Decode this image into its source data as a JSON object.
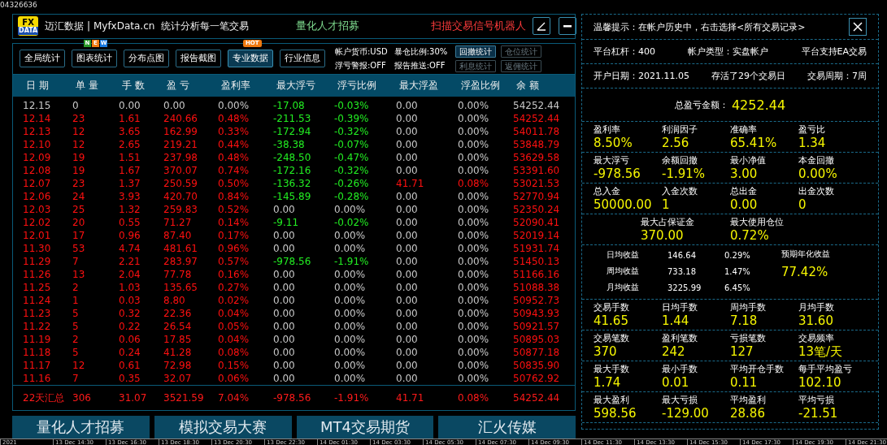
{
  "corner_id": "04326636",
  "header": {
    "logo_top": "FX",
    "logo_bottom": "DATA",
    "site": "迈汇数据 | MyfxData.cn",
    "slogan": "统计分析每一笔交易",
    "recruit": "量化人才招募",
    "robot": "扫描交易信号机器人"
  },
  "tabs": [
    {
      "label": "全局统计",
      "selected": false
    },
    {
      "label": "图表统计",
      "selected": false,
      "badge": {
        "kind": "letters",
        "letters": [
          "N",
          "E",
          "W"
        ]
      }
    },
    {
      "label": "分布点图",
      "selected": false
    },
    {
      "label": "报告截图",
      "selected": false
    },
    {
      "label": "专业数据",
      "selected": true,
      "badge": {
        "kind": "tag",
        "text": "HOT"
      }
    },
    {
      "label": "行业信息",
      "selected": false
    }
  ],
  "account_info": [
    "帐户货币:USD",
    "暴仓比例:30%",
    "浮亏警报:OFF",
    "报告推送:OFF"
  ],
  "side_buttons": [
    {
      "label": "回撤统计",
      "disabled": false
    },
    {
      "label": "仓位统计",
      "disabled": true
    },
    {
      "label": "利息统计",
      "disabled": true
    },
    {
      "label": "返佣统计",
      "disabled": true
    }
  ],
  "table": {
    "columns": [
      "日 期",
      "单 量",
      "手 数",
      "盈 亏",
      "盈利率",
      "最大浮亏",
      "浮亏比例",
      "最大浮盈",
      "浮盈比例",
      "余 额"
    ],
    "rows": [
      {
        "kind": "flat",
        "float_loss": true,
        "float_profit": false,
        "cells": [
          "12.15",
          "0",
          "0.00",
          "0.00",
          "0.00%",
          "-17.08",
          "-0.03%",
          "0.00",
          "0.00%",
          "54252.44"
        ]
      },
      {
        "kind": "gain",
        "float_loss": true,
        "float_profit": false,
        "cells": [
          "12.14",
          "23",
          "1.61",
          "240.66",
          "0.48%",
          "-211.53",
          "-0.39%",
          "0.00",
          "0.00%",
          "54252.44"
        ]
      },
      {
        "kind": "gain",
        "float_loss": true,
        "float_profit": false,
        "cells": [
          "12.13",
          "12",
          "3.65",
          "162.99",
          "0.33%",
          "-172.94",
          "-0.32%",
          "0.00",
          "0.00%",
          "54011.78"
        ]
      },
      {
        "kind": "gain",
        "float_loss": true,
        "float_profit": false,
        "cells": [
          "12.10",
          "12",
          "2.65",
          "219.21",
          "0.44%",
          "-38.38",
          "-0.07%",
          "0.00",
          "0.00%",
          "53848.79"
        ]
      },
      {
        "kind": "gain",
        "float_loss": true,
        "float_profit": false,
        "cells": [
          "12.09",
          "19",
          "1.51",
          "237.98",
          "0.48%",
          "-248.50",
          "-0.47%",
          "0.00",
          "0.00%",
          "53629.58"
        ]
      },
      {
        "kind": "gain",
        "float_loss": true,
        "float_profit": false,
        "cells": [
          "12.08",
          "19",
          "1.67",
          "370.07",
          "0.74%",
          "-172.16",
          "-0.32%",
          "0.00",
          "0.00%",
          "53391.60"
        ]
      },
      {
        "kind": "gain",
        "float_loss": true,
        "float_profit": true,
        "cells": [
          "12.07",
          "23",
          "1.37",
          "250.59",
          "0.50%",
          "-136.32",
          "-0.26%",
          "41.71",
          "0.08%",
          "53021.53"
        ]
      },
      {
        "kind": "gain",
        "float_loss": true,
        "float_profit": false,
        "cells": [
          "12.06",
          "24",
          "3.93",
          "420.70",
          "0.84%",
          "-145.89",
          "-0.28%",
          "0.00",
          "0.00%",
          "52770.94"
        ]
      },
      {
        "kind": "gain",
        "float_loss": false,
        "float_profit": false,
        "cells": [
          "12.03",
          "25",
          "1.32",
          "259.83",
          "0.52%",
          "0.00",
          "0.00%",
          "0.00",
          "0.00%",
          "52350.24"
        ]
      },
      {
        "kind": "gain",
        "float_loss": true,
        "float_profit": false,
        "cells": [
          "12.02",
          "20",
          "0.55",
          "71.27",
          "0.14%",
          "-9.11",
          "-0.02%",
          "0.00",
          "0.00%",
          "52090.41"
        ]
      },
      {
        "kind": "gain",
        "float_loss": false,
        "float_profit": false,
        "cells": [
          "12.01",
          "17",
          "0.96",
          "87.40",
          "0.17%",
          "0.00",
          "0.00%",
          "0.00",
          "0.00%",
          "52019.14"
        ]
      },
      {
        "kind": "gain",
        "float_loss": false,
        "float_profit": false,
        "cells": [
          "11.30",
          "53",
          "4.74",
          "481.61",
          "0.96%",
          "0.00",
          "0.00%",
          "0.00",
          "0.00%",
          "51931.74"
        ]
      },
      {
        "kind": "gain",
        "float_loss": true,
        "float_profit": false,
        "cells": [
          "11.29",
          "7",
          "2.21",
          "283.97",
          "0.57%",
          "-978.56",
          "-1.91%",
          "0.00",
          "0.00%",
          "51450.13"
        ]
      },
      {
        "kind": "gain",
        "float_loss": false,
        "float_profit": false,
        "cells": [
          "11.26",
          "13",
          "2.04",
          "77.78",
          "0.16%",
          "0.00",
          "0.00%",
          "0.00",
          "0.00%",
          "51166.16"
        ]
      },
      {
        "kind": "gain",
        "float_loss": false,
        "float_profit": false,
        "cells": [
          "11.25",
          "2",
          "1.03",
          "135.65",
          "0.27%",
          "0.00",
          "0.00%",
          "0.00",
          "0.00%",
          "51088.38"
        ]
      },
      {
        "kind": "gain",
        "float_loss": false,
        "float_profit": false,
        "cells": [
          "11.24",
          "1",
          "0.03",
          "8.80",
          "0.02%",
          "0.00",
          "0.00%",
          "0.00",
          "0.00%",
          "50952.73"
        ]
      },
      {
        "kind": "gain",
        "float_loss": false,
        "float_profit": false,
        "cells": [
          "11.23",
          "5",
          "0.32",
          "22.36",
          "0.04%",
          "0.00",
          "0.00%",
          "0.00",
          "0.00%",
          "50943.93"
        ]
      },
      {
        "kind": "gain",
        "float_loss": false,
        "float_profit": false,
        "cells": [
          "11.22",
          "5",
          "0.22",
          "26.54",
          "0.05%",
          "0.00",
          "0.00%",
          "0.00",
          "0.00%",
          "50921.57"
        ]
      },
      {
        "kind": "gain",
        "float_loss": false,
        "float_profit": false,
        "cells": [
          "11.19",
          "2",
          "0.06",
          "17.85",
          "0.04%",
          "0.00",
          "0.00%",
          "0.00",
          "0.00%",
          "50895.03"
        ]
      },
      {
        "kind": "gain",
        "float_loss": false,
        "float_profit": false,
        "cells": [
          "11.18",
          "5",
          "0.24",
          "41.28",
          "0.08%",
          "0.00",
          "0.00%",
          "0.00",
          "0.00%",
          "50877.18"
        ]
      },
      {
        "kind": "gain",
        "float_loss": false,
        "float_profit": false,
        "cells": [
          "11.17",
          "12",
          "0.61",
          "72.98",
          "0.15%",
          "0.00",
          "0.00%",
          "0.00",
          "0.00%",
          "50835.90"
        ]
      },
      {
        "kind": "gain",
        "float_loss": false,
        "float_profit": false,
        "cells": [
          "11.16",
          "7",
          "0.35",
          "32.07",
          "0.06%",
          "0.00",
          "0.00%",
          "0.00",
          "0.00%",
          "50762.92"
        ]
      }
    ],
    "summary": [
      "22天汇总",
      "306",
      "31.07",
      "3521.59",
      "7.04%",
      "-978.56",
      "-1.91%",
      "41.71",
      "0.08%",
      "54252.44"
    ]
  },
  "banners": [
    "量化人才招募",
    "模拟交易大赛",
    "MT4交易期货",
    "汇火传媒"
  ],
  "stats_panel": {
    "tip": "温馨提示：在帐户历史中，右击选择<所有交易记录>",
    "info_rows": [
      [
        "平台杠杆：400",
        "帐户类型：实盘帐户",
        "平台支持EA交易"
      ],
      [
        "开户日期：2021.11.05",
        "存活了29个交易日",
        "交易周期：7周"
      ]
    ],
    "total": {
      "label": "总盈亏金额：",
      "value": "4252.44"
    },
    "groups_a": [
      [
        {
          "label": "盈利率",
          "value": "8.50%"
        },
        {
          "label": "利润因子",
          "value": "2.56"
        },
        {
          "label": "准确率",
          "value": "65.41%"
        },
        {
          "label": "盈亏比",
          "value": "1.34"
        }
      ],
      [
        {
          "label": "最大浮亏",
          "value": "-978.56"
        },
        {
          "label": "余额回撤",
          "value": "-1.91%"
        },
        {
          "label": "最小净值",
          "value": "3.00"
        },
        {
          "label": "本金回撤",
          "value": "0.00%"
        }
      ],
      [
        {
          "label": "总入金",
          "value": "50000.00"
        },
        {
          "label": "入金次数",
          "value": "1"
        },
        {
          "label": "总出金",
          "value": "0.00"
        },
        {
          "label": "出金次数",
          "value": "0"
        }
      ]
    ],
    "margin": [
      {
        "label": "最大占保证金",
        "value": "370.00"
      },
      {
        "label": "最大使用仓位",
        "value": "0.72%"
      }
    ],
    "averages": [
      [
        "日均收益",
        "146.64",
        "0.29%"
      ],
      [
        "周均收益",
        "733.18",
        "1.47%"
      ],
      [
        "月均收益",
        "3225.99",
        "6.45%"
      ]
    ],
    "forecast": {
      "label": "预期年化收益",
      "value": "77.42%"
    },
    "groups_b": [
      [
        {
          "label": "交易手数",
          "value": "41.65"
        },
        {
          "label": "日均手数",
          "value": "1.44"
        },
        {
          "label": "周均手数",
          "value": "7.18"
        },
        {
          "label": "月均手数",
          "value": "31.60"
        }
      ],
      [
        {
          "label": "交易笔数",
          "value": "370"
        },
        {
          "label": "盈利笔数",
          "value": "242"
        },
        {
          "label": "亏损笔数",
          "value": "127"
        },
        {
          "label": "交易频率",
          "value": "13笔/天"
        }
      ],
      [
        {
          "label": "最大手数",
          "value": "1.74"
        },
        {
          "label": "最小手数",
          "value": "0.01"
        },
        {
          "label": "平均开仓手数",
          "value": "0.11"
        },
        {
          "label": "每手平均盈亏",
          "value": "102.10"
        }
      ],
      [
        {
          "label": "最大盈利",
          "value": "598.56"
        },
        {
          "label": "最大亏损",
          "value": "-129.00"
        },
        {
          "label": "平均盈利",
          "value": "28.86"
        },
        {
          "label": "平均亏损",
          "value": "-21.51"
        }
      ]
    ]
  },
  "time_axis": [
    "2021",
    "13 Dec 14:30",
    "13 Dec 16:30",
    "13 Dec 18:30",
    "13 Dec 20:30",
    "13 Dec 22:30",
    "14 Dec 01:30",
    "14 Dec 03:30",
    "14 Dec 05:30",
    "14 Dec 07:30",
    "14 Dec 09:30",
    "14 Dec 11:30",
    "14 Dec 13:30",
    "14 Dec 15:30",
    "14 Dec 17:30",
    "14 Dec 19:30",
    "14 Dec 21:30"
  ]
}
